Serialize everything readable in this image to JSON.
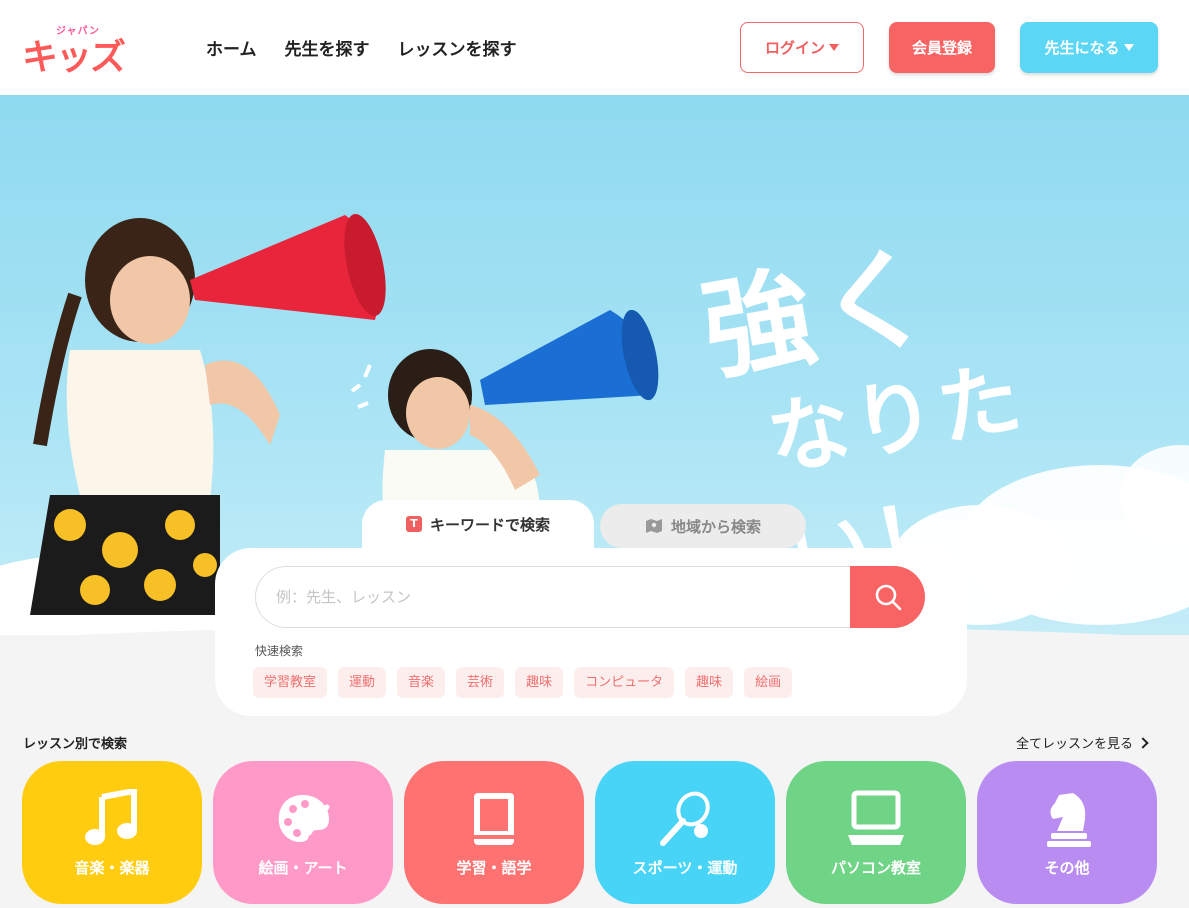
{
  "header": {
    "logo_text": "キッズ",
    "logo_sub": "ジャパン",
    "nav": [
      {
        "label": "ホーム"
      },
      {
        "label": "先生を探す"
      },
      {
        "label": "レッスンを探す"
      }
    ],
    "login_label": "ログイン",
    "register_label": "会員登録",
    "teacher_label": "先生になる"
  },
  "hero": {
    "catch_line1": "強く",
    "catch_line2": "なりたい！"
  },
  "search": {
    "tabs": [
      {
        "label": "キーワードで検索",
        "icon": "t-icon",
        "active": true
      },
      {
        "label": "地域から検索",
        "icon": "map-icon",
        "active": false
      }
    ],
    "placeholder": "例：先生、レッスン",
    "quick_label": "快速検索",
    "quick_tags": [
      "学習教室",
      "運動",
      "音楽",
      "芸術",
      "趣味",
      "コンピュータ",
      "趣味",
      "絵画"
    ]
  },
  "lessons": {
    "title": "レッスン別で検索",
    "see_all": "全てレッスンを見る",
    "categories": [
      {
        "label": "音楽・楽器",
        "icon": "music-note-icon",
        "color": "#ffcc10"
      },
      {
        "label": "絵画・アート",
        "icon": "palette-icon",
        "color": "#ff9ac8"
      },
      {
        "label": "学習・語学",
        "icon": "book-icon",
        "color": "#ff7272"
      },
      {
        "label": "スポーツ・運動",
        "icon": "tennis-racket-icon",
        "color": "#48d4f7"
      },
      {
        "label": "パソコン教室",
        "icon": "computer-icon",
        "color": "#6fd486"
      },
      {
        "label": "その他",
        "icon": "chess-knight-icon",
        "color": "#b98cf2"
      }
    ]
  },
  "colors": {
    "brand_red": "#f86464",
    "brand_blue": "#5cd6f5"
  }
}
